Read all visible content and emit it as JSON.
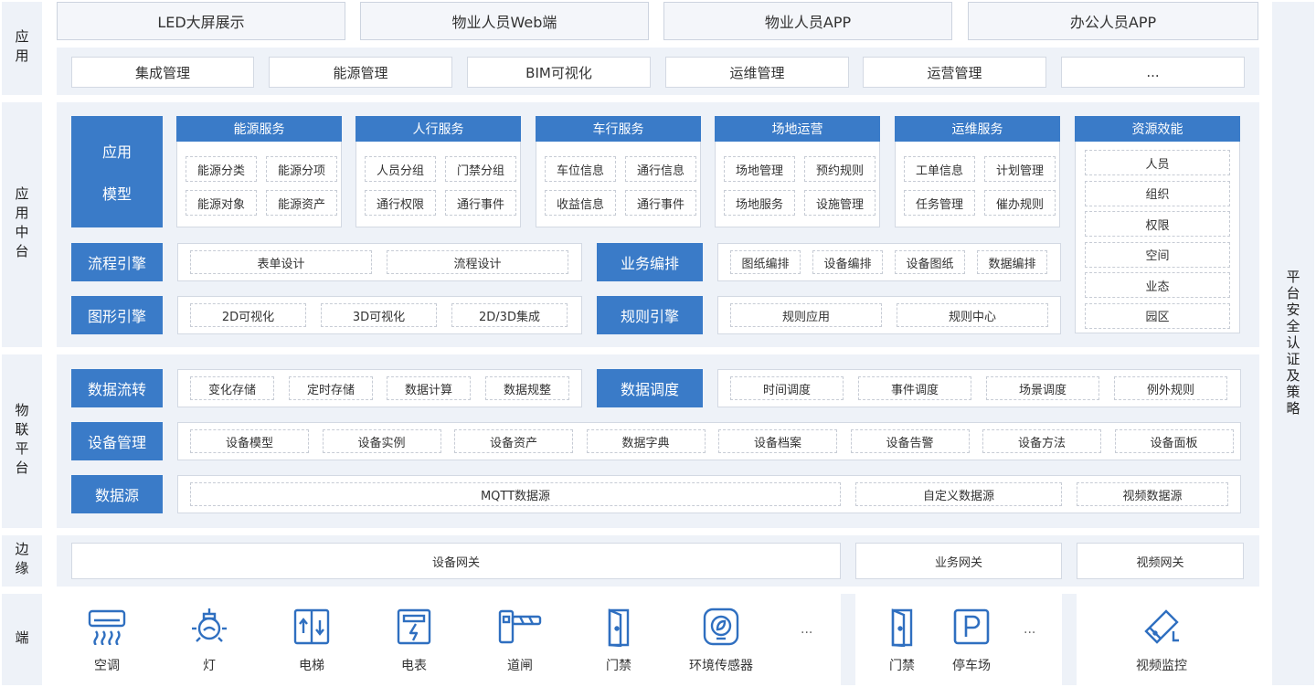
{
  "layers": {
    "app": "应用",
    "middle": "应用中台",
    "iot": "物联平台",
    "edge": "边缘",
    "end": "端",
    "security": "平台安全认证及策略"
  },
  "clients": [
    "LED大屏展示",
    "物业人员Web端",
    "物业人员APP",
    "办公人员APP"
  ],
  "apps": [
    "集成管理",
    "能源管理",
    "BIM可视化",
    "运维管理",
    "运营管理",
    "..."
  ],
  "app_model": {
    "line1": "应用",
    "line2": "模型"
  },
  "services": [
    {
      "title": "能源服务",
      "items": [
        "能源分类",
        "能源分项",
        "能源对象",
        "能源资产"
      ]
    },
    {
      "title": "人行服务",
      "items": [
        "人员分组",
        "门禁分组",
        "通行权限",
        "通行事件"
      ]
    },
    {
      "title": "车行服务",
      "items": [
        "车位信息",
        "通行信息",
        "收益信息",
        "通行事件"
      ]
    },
    {
      "title": "场地运营",
      "items": [
        "场地管理",
        "预约规则",
        "场地服务",
        "设施管理"
      ]
    },
    {
      "title": "运维服务",
      "items": [
        "工单信息",
        "计划管理",
        "任务管理",
        "催办规则"
      ]
    }
  ],
  "resource": {
    "title": "资源效能",
    "items": [
      "人员",
      "组织",
      "权限",
      "空间",
      "业态",
      "园区"
    ]
  },
  "engines": {
    "process": {
      "label": "流程引擎",
      "items": [
        "表单设计",
        "流程设计"
      ]
    },
    "business": {
      "label": "业务编排",
      "items": [
        "图纸编排",
        "设备编排",
        "设备图纸",
        "数据编排"
      ]
    },
    "graphics": {
      "label": "图形引擎",
      "items": [
        "2D可视化",
        "3D可视化",
        "2D/3D集成"
      ]
    },
    "rules": {
      "label": "规则引擎",
      "items": [
        "规则应用",
        "规则中心"
      ]
    }
  },
  "iot": {
    "flow": {
      "label": "数据流转",
      "items": [
        "变化存储",
        "定时存储",
        "数据计算",
        "数据规整"
      ]
    },
    "schedule": {
      "label": "数据调度",
      "items": [
        "时间调度",
        "事件调度",
        "场景调度",
        "例外规则"
      ]
    },
    "device": {
      "label": "设备管理",
      "items": [
        "设备模型",
        "设备实例",
        "设备资产",
        "数据字典",
        "设备档案",
        "设备告警",
        "设备方法",
        "设备面板"
      ]
    },
    "source": {
      "label": "数据源",
      "items": [
        "MQTT数据源",
        "自定义数据源",
        "视频数据源"
      ]
    }
  },
  "gateways": [
    "设备网关",
    "业务网关",
    "视频网关"
  ],
  "devices": {
    "group1": [
      {
        "label": "空调",
        "icon": "air-conditioner-icon"
      },
      {
        "label": "灯",
        "icon": "light-bulb-icon"
      },
      {
        "label": "电梯",
        "icon": "elevator-icon"
      },
      {
        "label": "电表",
        "icon": "electric-meter-icon"
      },
      {
        "label": "道闸",
        "icon": "barrier-gate-icon"
      },
      {
        "label": "门禁",
        "icon": "door-access-icon"
      },
      {
        "label": "环境传感器",
        "icon": "environment-sensor-icon"
      }
    ],
    "group1_more": "...",
    "group2": [
      {
        "label": "门禁",
        "icon": "door-access-icon"
      },
      {
        "label": "停车场",
        "icon": "parking-icon"
      }
    ],
    "group2_more": "...",
    "group3": [
      {
        "label": "视频监控",
        "icon": "camera-icon"
      }
    ]
  },
  "colors": {
    "blue": "#3a7bc8",
    "band": "#eef2f8",
    "icon": "#2f6fc0"
  }
}
